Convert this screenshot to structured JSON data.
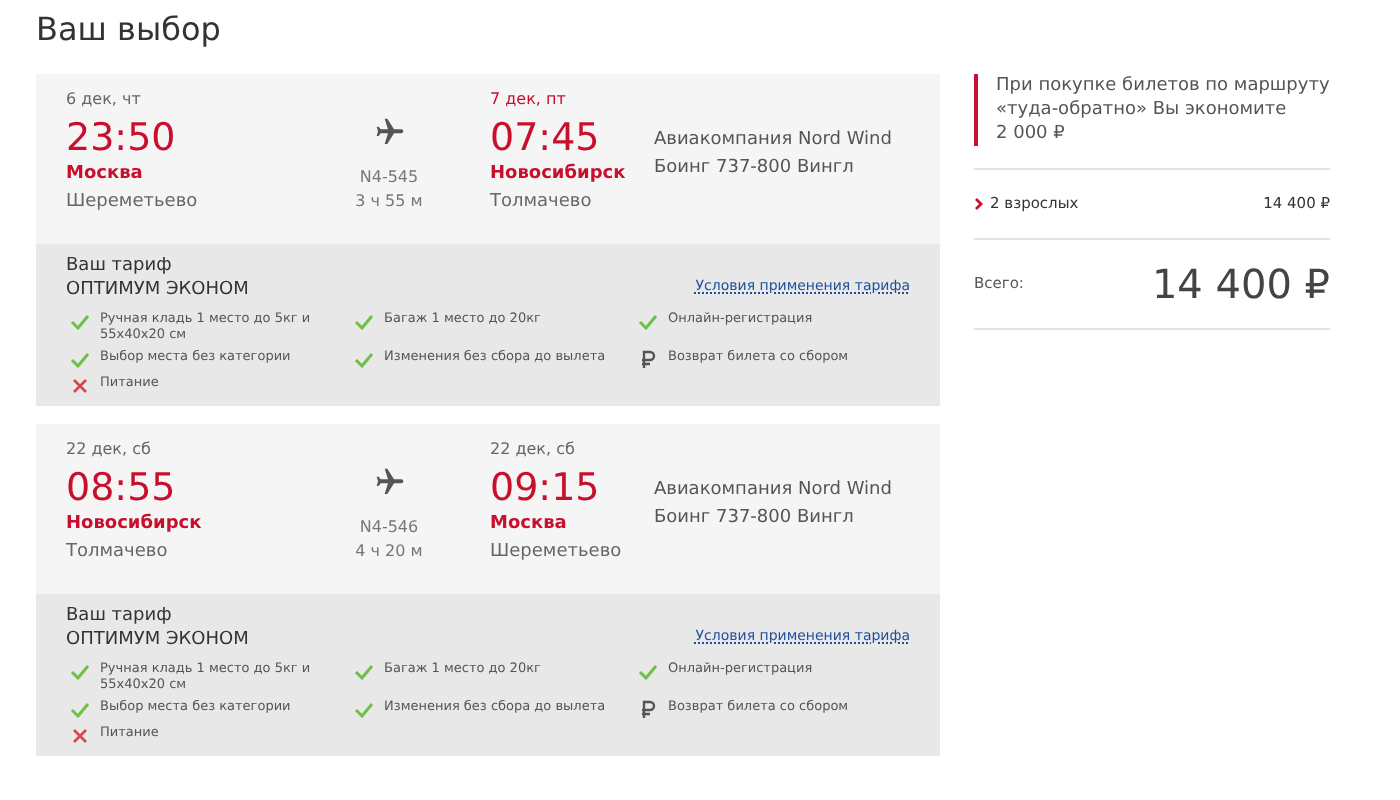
{
  "title": "Ваш выбор",
  "flights": [
    {
      "departure": {
        "date": "6 дек, чт",
        "date_highlight": false,
        "time": "23:50",
        "city": "Москва",
        "airport": "Шереметьево"
      },
      "flight_number": "N4-545",
      "duration": "3 ч 55 м",
      "arrival": {
        "date": "7 дек, пт",
        "date_highlight": true,
        "time": "07:45",
        "city": "Новосибирск",
        "airport": "Толмачево"
      },
      "airline": "Авиакомпания Nord Wind",
      "aircraft": "Боинг 737-800 Вингл",
      "fare_label": "Ваш тариф",
      "fare_name": "ОПТИМУМ ЭКОНОМ",
      "fare_link": "Условия применения тарифа",
      "features": [
        {
          "kind": "included",
          "text": "Ручная кладь 1 место до 5кг и 55х40х20 см"
        },
        {
          "kind": "included",
          "text": "Багаж 1 место до 20кг"
        },
        {
          "kind": "included",
          "text": "Онлайн-регистрация"
        },
        {
          "kind": "included",
          "text": "Выбор места без категории"
        },
        {
          "kind": "included",
          "text": "Изменения без сбора до вылета"
        },
        {
          "kind": "paid",
          "text": "Возврат билета со сбором"
        },
        {
          "kind": "excluded",
          "text": "Питание"
        }
      ]
    },
    {
      "departure": {
        "date": "22 дек, сб",
        "date_highlight": false,
        "time": "08:55",
        "city": "Новосибирск",
        "airport": "Толмачево"
      },
      "flight_number": "N4-546",
      "duration": "4 ч 20 м",
      "arrival": {
        "date": "22 дек, сб",
        "date_highlight": false,
        "time": "09:15",
        "city": "Москва",
        "airport": "Шереметьево"
      },
      "airline": "Авиакомпания Nord Wind",
      "aircraft": "Боинг 737-800 Вингл",
      "fare_label": "Ваш тариф",
      "fare_name": "ОПТИМУМ ЭКОНОМ",
      "fare_link": "Условия применения тарифа",
      "features": [
        {
          "kind": "included",
          "text": "Ручная кладь 1 место до 5кг и 55х40х20 см"
        },
        {
          "kind": "included",
          "text": "Багаж 1 место до 20кг"
        },
        {
          "kind": "included",
          "text": "Онлайн-регистрация"
        },
        {
          "kind": "included",
          "text": "Выбор места без категории"
        },
        {
          "kind": "included",
          "text": "Изменения без сбора до вылета"
        },
        {
          "kind": "paid",
          "text": "Возврат билета со сбором"
        },
        {
          "kind": "excluded",
          "text": "Питание"
        }
      ]
    }
  ],
  "summary": {
    "savings_text": "При покупке билетов по маршруту «туда-обратно» Вы экономите",
    "savings_amount": "2 000 ₽",
    "passengers": "2 взрослых",
    "passengers_price": "14 400 ₽",
    "total_label": "Всего:",
    "total": "14 400 ₽"
  }
}
